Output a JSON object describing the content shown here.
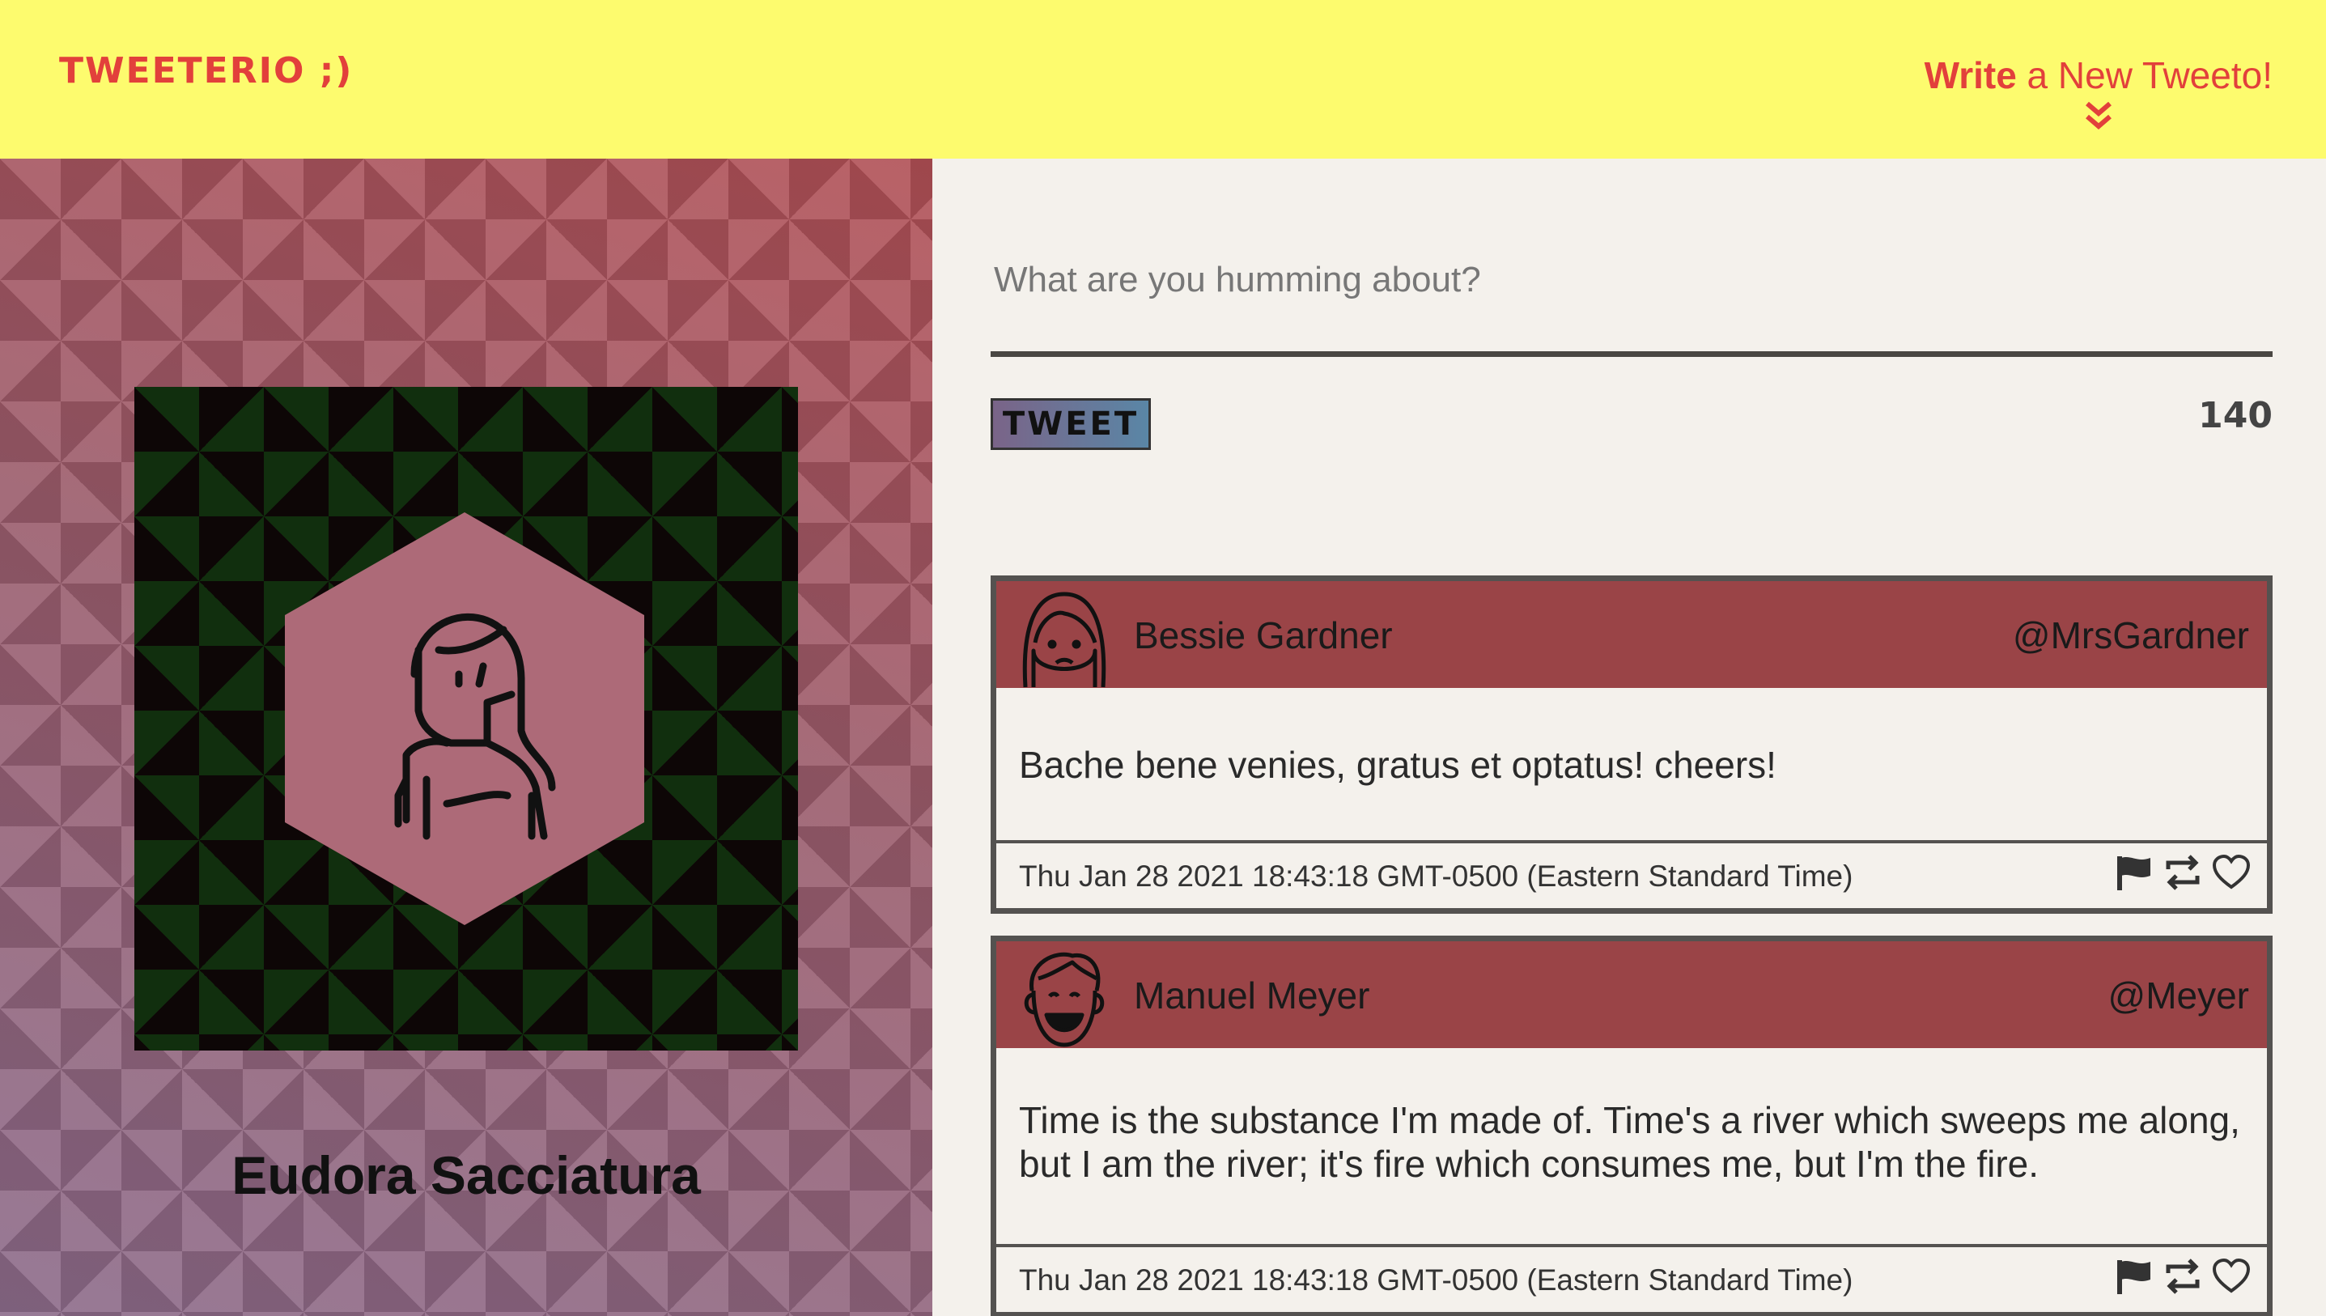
{
  "nav": {
    "brand": "Tweeterio ;)",
    "compose_strong": "Write",
    "compose_rest": " a New Tweeto!"
  },
  "profile": {
    "name": "Eudora Sacciatura"
  },
  "composer": {
    "placeholder": "What are you humming about?",
    "button_label": "Tweet",
    "char_count": "140"
  },
  "tweets": [
    {
      "name": "Bessie Gardner",
      "handle": "@MrsGardner",
      "text": "Bache bene venies, gratus et optatus! cheers!",
      "time": "Thu Jan 28 2021 18:43:18 GMT-0500 (Eastern Standard Time)",
      "avatar_icon": "woman-face-icon"
    },
    {
      "name": "Manuel Meyer",
      "handle": "@Meyer",
      "text": "Time is the substance I'm made of. Time's a river which sweeps me along, but I am the river; it's fire which consumes me, but I'm the fire.",
      "time": "Thu Jan 28 2021 18:43:18 GMT-0500 (Eastern Standard Time)",
      "avatar_icon": "man-face-icon"
    }
  ],
  "icons": {
    "flag": "flag-icon",
    "retweet": "retweet-icon",
    "like": "heart-icon",
    "compose_arrow": "double-chevron-down-icon"
  },
  "colors": {
    "nav_bg": "#fdfb6e",
    "brand": "#e2403b",
    "tweet_header": "#9a4447",
    "page_bg": "#f4f1ec"
  }
}
